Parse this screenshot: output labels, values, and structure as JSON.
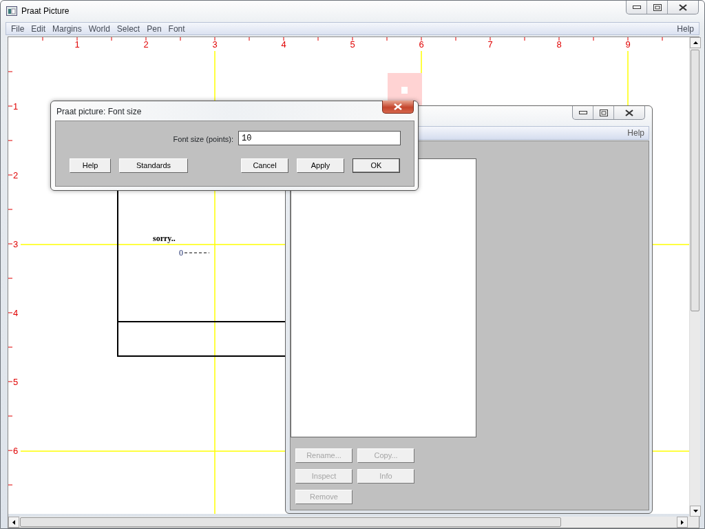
{
  "main_window": {
    "title": "Praat Picture",
    "menu": [
      {
        "label": "File"
      },
      {
        "label": "Edit"
      },
      {
        "label": "Margins"
      },
      {
        "label": "World"
      },
      {
        "label": "Select"
      },
      {
        "label": "Pen"
      },
      {
        "label": "Font"
      }
    ],
    "help_menu": "Help"
  },
  "canvas": {
    "x_ruler": [
      "1",
      "2",
      "3",
      "4",
      "5",
      "6",
      "7",
      "8",
      "9"
    ],
    "y_ruler": [
      "1",
      "2",
      "3",
      "4",
      "5",
      "6"
    ],
    "texts": [
      {
        "text": "sorry..",
        "kind": "label"
      },
      {
        "text": "0",
        "kind": "axis-value"
      }
    ]
  },
  "objects_window": {
    "help_menu": "Help",
    "buttons": [
      {
        "label": "Rename...",
        "disabled": true
      },
      {
        "label": "Copy...",
        "disabled": true
      },
      {
        "label": "Inspect",
        "disabled": true
      },
      {
        "label": "Info",
        "disabled": true
      },
      {
        "label": "Remove",
        "disabled": true
      }
    ]
  },
  "dialog": {
    "title": "Praat picture: Font size",
    "field": {
      "label": "Font size (points):",
      "value": "10"
    },
    "buttons": [
      {
        "label": "Help",
        "default": false
      },
      {
        "label": "Standards",
        "default": false
      },
      {
        "label": "Cancel",
        "default": false
      },
      {
        "label": "Apply",
        "default": false
      },
      {
        "label": "OK",
        "default": true
      }
    ]
  }
}
